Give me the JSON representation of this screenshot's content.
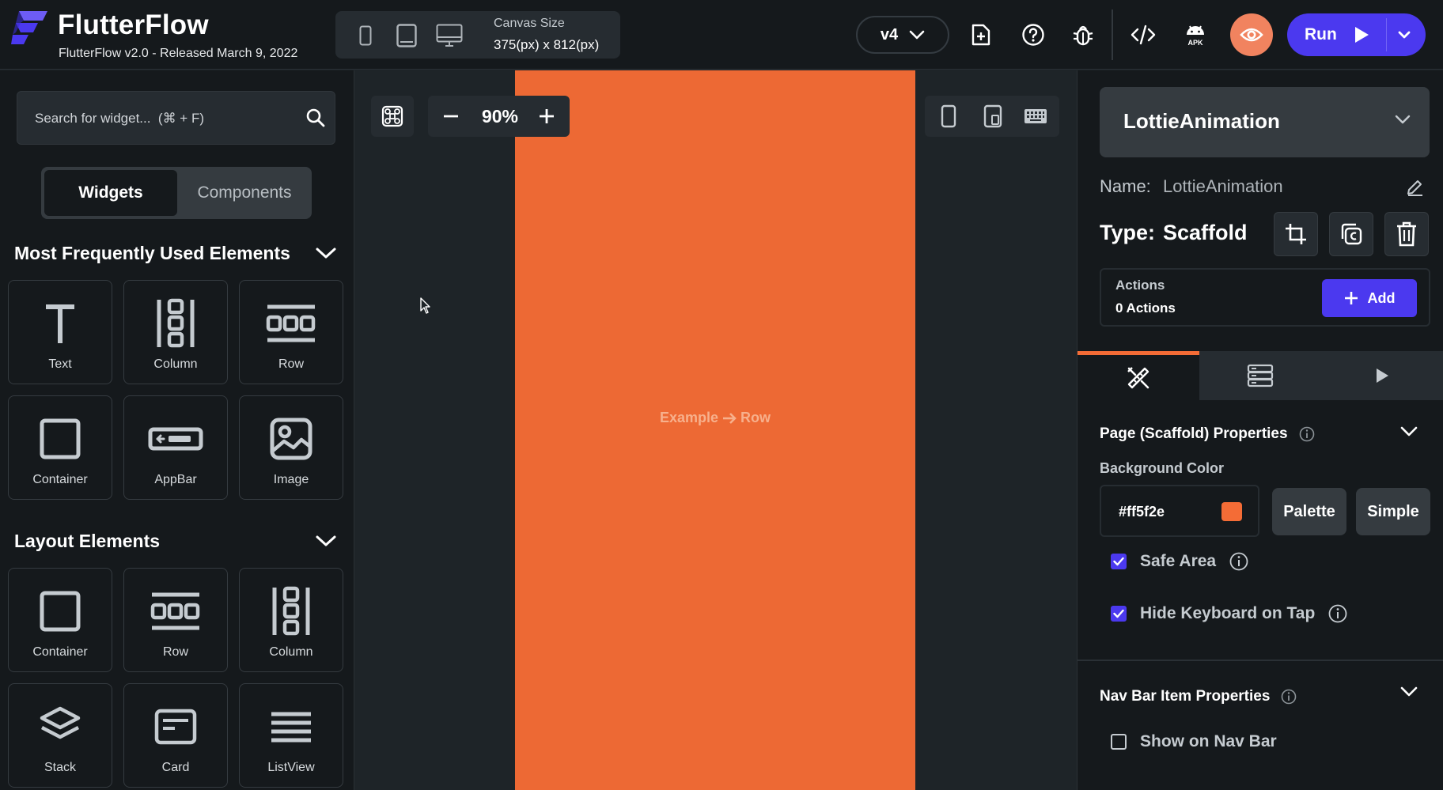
{
  "app": {
    "title": "FlutterFlow",
    "subtitle": "FlutterFlow v2.0 - Released March 9, 2022"
  },
  "toolbar": {
    "canvas_size_label": "Canvas Size",
    "canvas_size_value": "375(px) x 812(px)",
    "version": "v4",
    "run_label": "Run",
    "preview_color": "#f1835f",
    "run_color": "#4b39ef"
  },
  "left_panel": {
    "search_placeholder": "Search for widget...  (⌘ + F)",
    "tabs": {
      "widgets": "Widgets",
      "components": "Components"
    },
    "sections": [
      {
        "title": "Most Frequently Used Elements",
        "items": [
          {
            "label": "Text",
            "icon": "text-icon"
          },
          {
            "label": "Column",
            "icon": "column-icon"
          },
          {
            "label": "Row",
            "icon": "row-icon"
          },
          {
            "label": "Container",
            "icon": "container-icon"
          },
          {
            "label": "AppBar",
            "icon": "appbar-icon"
          },
          {
            "label": "Image",
            "icon": "image-icon"
          }
        ]
      },
      {
        "title": "Layout Elements",
        "items": [
          {
            "label": "Container",
            "icon": "container-icon"
          },
          {
            "label": "Row",
            "icon": "row-icon"
          },
          {
            "label": "Column",
            "icon": "column-icon"
          },
          {
            "label": "Stack",
            "icon": "stack-icon"
          },
          {
            "label": "Card",
            "icon": "card-icon"
          },
          {
            "label": "ListView",
            "icon": "listview-icon"
          }
        ]
      }
    ]
  },
  "canvas": {
    "zoom": "90%",
    "example_left": "Example",
    "example_right": "Row",
    "background": "#ff5f2e"
  },
  "right_panel": {
    "selected_widget": "LottieAnimation",
    "name_label": "Name:",
    "name_value": "LottieAnimation",
    "type_label": "Type:",
    "type_value": "Scaffold",
    "actions_title": "Actions",
    "actions_count": "0 Actions",
    "add_label": "Add",
    "page_props_title": "Page (Scaffold) Properties",
    "bg_color_label": "Background Color",
    "bg_color_value": "#ff5f2e",
    "palette_label": "Palette",
    "simple_label": "Simple",
    "safe_area_label": "Safe Area",
    "safe_area_checked": true,
    "hide_keyboard_label": "Hide Keyboard on Tap",
    "hide_keyboard_checked": true,
    "nav_props_title": "Nav Bar Item Properties",
    "show_nav_label": "Show on Nav Bar",
    "show_nav_checked": false,
    "accent_color": "#f46c36"
  }
}
